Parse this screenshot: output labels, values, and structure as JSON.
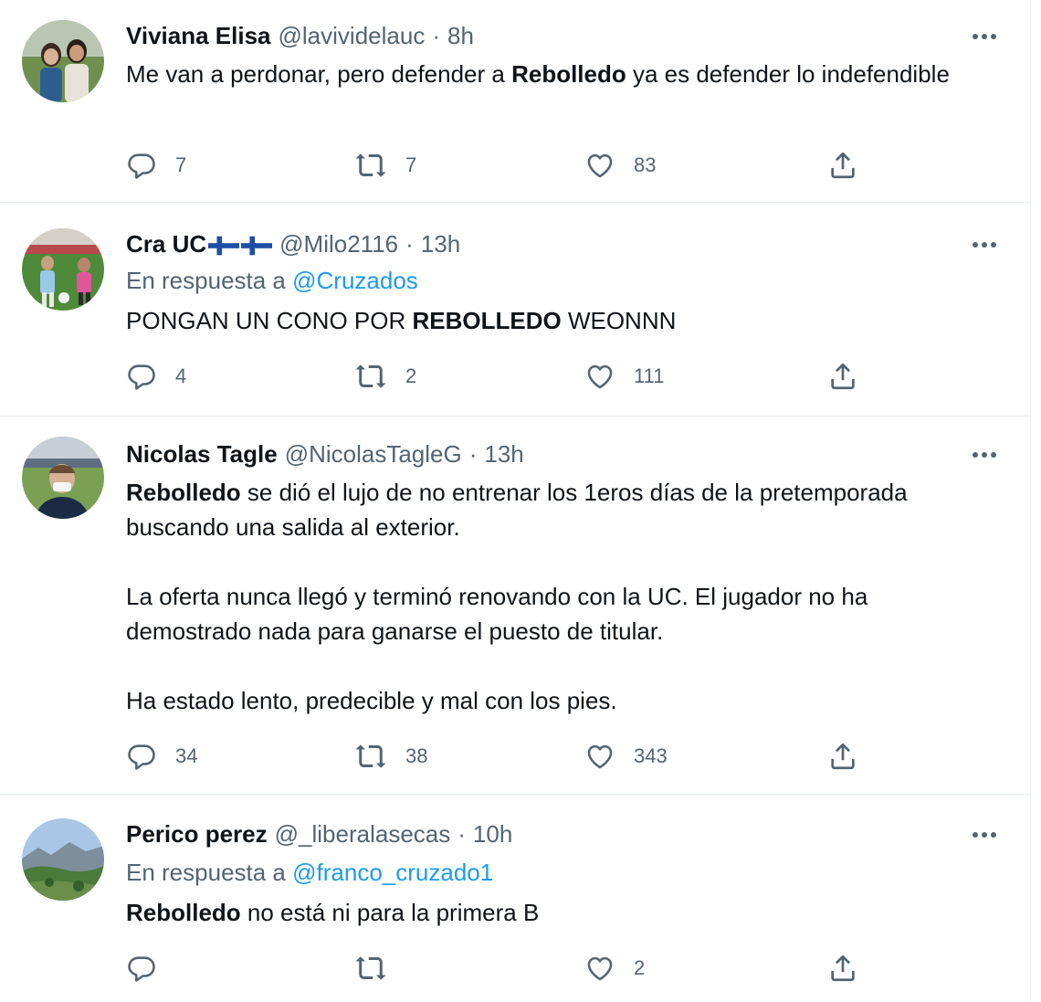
{
  "tweets": [
    {
      "name": "Viviana Elisa",
      "handle": "@lavividelauc",
      "dot": "·",
      "time": "8h",
      "text_parts": [
        "Me van a perdonar, pero defender a ",
        "Rebolledo",
        " ya es defender lo indefendible"
      ],
      "replies": "7",
      "retweets": "7",
      "likes": "83"
    },
    {
      "name": "Cra UC",
      "handle": "@Milo2116",
      "dot": "·",
      "time": "13h",
      "reply_prefix": "En respuesta a ",
      "reply_to": "@Cruzados",
      "text_parts": [
        "PONGAN UN CONO POR ",
        "REBOLLEDO",
        " WEONNN"
      ],
      "replies": "4",
      "retweets": "2",
      "likes": "111"
    },
    {
      "name": "Nicolas Tagle",
      "handle": "@NicolasTagleG",
      "dot": "·",
      "time": "13h",
      "text_parts": [
        "Rebolledo",
        " se dió el lujo de no entrenar los 1eros días de la pretemporada buscando una salida al exterior."
      ],
      "paragraph2": "La oferta nunca llegó y terminó renovando con la UC. El jugador no ha demostrado nada para ganarse el puesto de titular.",
      "paragraph3": "Ha estado lento, predecible y mal con los pies.",
      "replies": "34",
      "retweets": "38",
      "likes": "343"
    },
    {
      "name": "Perico perez",
      "handle": "@_liberalasecas",
      "dot": "·",
      "time": "10h",
      "reply_prefix": "En respuesta a ",
      "reply_to": "@franco_cruzado1",
      "text_parts": [
        "Rebolledo",
        " no está ni para la primera B"
      ],
      "replies": "",
      "retweets": "",
      "likes": "2"
    }
  ],
  "colors": {
    "text_primary": "#0f1419",
    "text_secondary": "#536471",
    "link": "#1d9bf0",
    "divider": "#e6ecf0"
  },
  "icons": [
    "reply-icon",
    "retweet-icon",
    "like-icon",
    "share-icon",
    "more-icon",
    "finland-flag-icon"
  ]
}
